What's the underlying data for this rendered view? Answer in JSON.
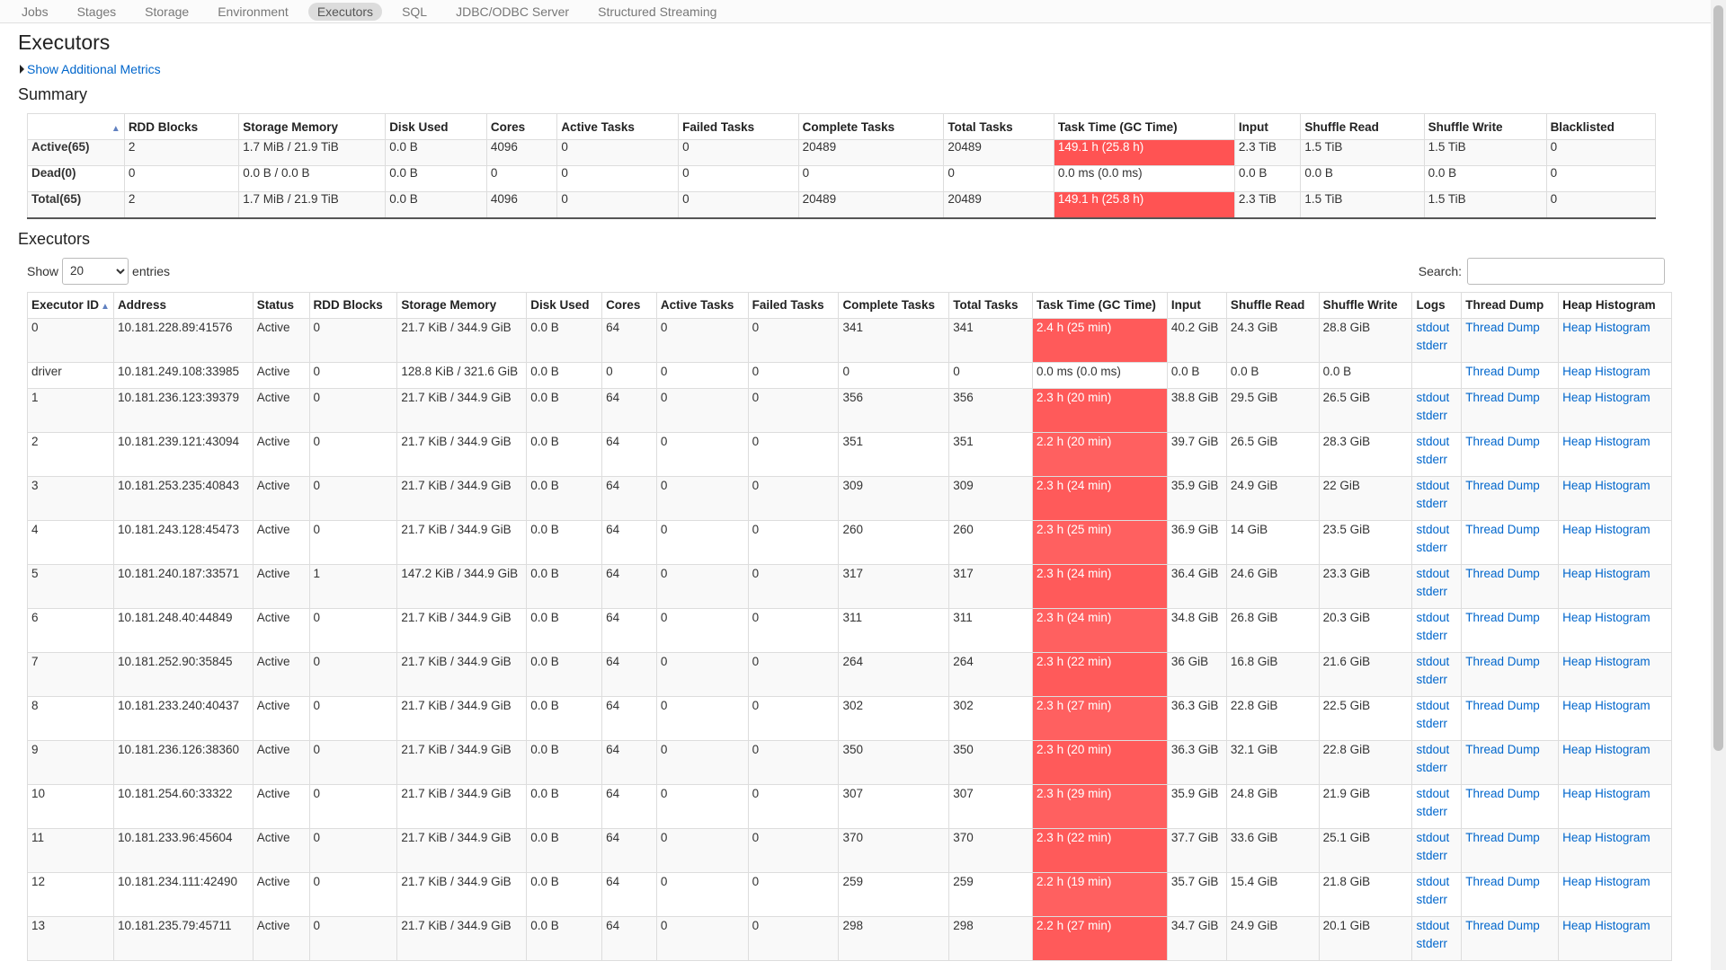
{
  "nav": [
    "Jobs",
    "Stages",
    "Storage",
    "Environment",
    "Executors",
    "SQL",
    "JDBC/ODBC Server",
    "Structured Streaming"
  ],
  "nav_active": "Executors",
  "page_title": "Executors",
  "show_more": "Show Additional Metrics",
  "summary_title": "Summary",
  "summary_headers": [
    "",
    "RDD Blocks",
    "Storage Memory",
    "Disk Used",
    "Cores",
    "Active Tasks",
    "Failed Tasks",
    "Complete Tasks",
    "Total Tasks",
    "Task Time (GC Time)",
    "Input",
    "Shuffle Read",
    "Shuffle Write",
    "Blacklisted"
  ],
  "summary_rows": [
    [
      "Active(65)",
      "2",
      "1.7 MiB / 21.9 TiB",
      "0.0 B",
      "4096",
      "0",
      "0",
      "20489",
      "20489",
      "149.1 h (25.8 h)",
      "2.3 TiB",
      "1.5 TiB",
      "1.5 TiB",
      "0"
    ],
    [
      "Dead(0)",
      "0",
      "0.0 B / 0.0 B",
      "0.0 B",
      "0",
      "0",
      "0",
      "0",
      "0",
      "0.0 ms (0.0 ms)",
      "0.0 B",
      "0.0 B",
      "0.0 B",
      "0"
    ],
    [
      "Total(65)",
      "2",
      "1.7 MiB / 21.9 TiB",
      "0.0 B",
      "4096",
      "0",
      "0",
      "20489",
      "20489",
      "149.1 h (25.8 h)",
      "2.3 TiB",
      "1.5 TiB",
      "1.5 TiB",
      "0"
    ]
  ],
  "executors_title": "Executors",
  "show_label": "Show",
  "entries_value": "20",
  "entries_label": "entries",
  "search_label": "Search:",
  "search_value": "",
  "exec_headers": [
    "Executor ID",
    "Address",
    "Status",
    "RDD Blocks",
    "Storage Memory",
    "Disk Used",
    "Cores",
    "Active Tasks",
    "Failed Tasks",
    "Complete Tasks",
    "Total Tasks",
    "Task Time (GC Time)",
    "Input",
    "Shuffle Read",
    "Shuffle Write",
    "Logs",
    "Thread Dump",
    "Heap Histogram"
  ],
  "log_links": [
    "stdout",
    "stderr"
  ],
  "thread_dump_label": "Thread Dump",
  "heap_histogram_label": "Heap Histogram",
  "executors": [
    {
      "id": "0",
      "address": "10.181.228.89:41576",
      "status": "Active",
      "rdd": "0",
      "storage": "21.7 KiB / 344.9 GiB",
      "disk": "0.0 B",
      "cores": "64",
      "active": "0",
      "failed": "0",
      "complete": "341",
      "total": "341",
      "task_time": "2.4 h (25 min)",
      "input": "40.2 GiB",
      "shuffle_read": "24.3 GiB",
      "shuffle_write": "28.8 GiB",
      "logs": true
    },
    {
      "id": "driver",
      "address": "10.181.249.108:33985",
      "status": "Active",
      "rdd": "0",
      "storage": "128.8 KiB / 321.6 GiB",
      "disk": "0.0 B",
      "cores": "0",
      "active": "0",
      "failed": "0",
      "complete": "0",
      "total": "0",
      "task_time": "0.0 ms (0.0 ms)",
      "input": "0.0 B",
      "shuffle_read": "0.0 B",
      "shuffle_write": "0.0 B",
      "logs": false
    },
    {
      "id": "1",
      "address": "10.181.236.123:39379",
      "status": "Active",
      "rdd": "0",
      "storage": "21.7 KiB / 344.9 GiB",
      "disk": "0.0 B",
      "cores": "64",
      "active": "0",
      "failed": "0",
      "complete": "356",
      "total": "356",
      "task_time": "2.3 h (20 min)",
      "input": "38.8 GiB",
      "shuffle_read": "29.5 GiB",
      "shuffle_write": "26.5 GiB",
      "logs": true
    },
    {
      "id": "2",
      "address": "10.181.239.121:43094",
      "status": "Active",
      "rdd": "0",
      "storage": "21.7 KiB / 344.9 GiB",
      "disk": "0.0 B",
      "cores": "64",
      "active": "0",
      "failed": "0",
      "complete": "351",
      "total": "351",
      "task_time": "2.2 h (20 min)",
      "input": "39.7 GiB",
      "shuffle_read": "26.5 GiB",
      "shuffle_write": "28.3 GiB",
      "logs": true
    },
    {
      "id": "3",
      "address": "10.181.253.235:40843",
      "status": "Active",
      "rdd": "0",
      "storage": "21.7 KiB / 344.9 GiB",
      "disk": "0.0 B",
      "cores": "64",
      "active": "0",
      "failed": "0",
      "complete": "309",
      "total": "309",
      "task_time": "2.3 h (24 min)",
      "input": "35.9 GiB",
      "shuffle_read": "24.9 GiB",
      "shuffle_write": "22 GiB",
      "logs": true
    },
    {
      "id": "4",
      "address": "10.181.243.128:45473",
      "status": "Active",
      "rdd": "0",
      "storage": "21.7 KiB / 344.9 GiB",
      "disk": "0.0 B",
      "cores": "64",
      "active": "0",
      "failed": "0",
      "complete": "260",
      "total": "260",
      "task_time": "2.3 h (25 min)",
      "input": "36.9 GiB",
      "shuffle_read": "14 GiB",
      "shuffle_write": "23.5 GiB",
      "logs": true
    },
    {
      "id": "5",
      "address": "10.181.240.187:33571",
      "status": "Active",
      "rdd": "1",
      "storage": "147.2 KiB / 344.9 GiB",
      "disk": "0.0 B",
      "cores": "64",
      "active": "0",
      "failed": "0",
      "complete": "317",
      "total": "317",
      "task_time": "2.3 h (24 min)",
      "input": "36.4 GiB",
      "shuffle_read": "24.6 GiB",
      "shuffle_write": "23.3 GiB",
      "logs": true
    },
    {
      "id": "6",
      "address": "10.181.248.40:44849",
      "status": "Active",
      "rdd": "0",
      "storage": "21.7 KiB / 344.9 GiB",
      "disk": "0.0 B",
      "cores": "64",
      "active": "0",
      "failed": "0",
      "complete": "311",
      "total": "311",
      "task_time": "2.3 h (24 min)",
      "input": "34.8 GiB",
      "shuffle_read": "26.8 GiB",
      "shuffle_write": "20.3 GiB",
      "logs": true
    },
    {
      "id": "7",
      "address": "10.181.252.90:35845",
      "status": "Active",
      "rdd": "0",
      "storage": "21.7 KiB / 344.9 GiB",
      "disk": "0.0 B",
      "cores": "64",
      "active": "0",
      "failed": "0",
      "complete": "264",
      "total": "264",
      "task_time": "2.3 h (22 min)",
      "input": "36 GiB",
      "shuffle_read": "16.8 GiB",
      "shuffle_write": "21.6 GiB",
      "logs": true
    },
    {
      "id": "8",
      "address": "10.181.233.240:40437",
      "status": "Active",
      "rdd": "0",
      "storage": "21.7 KiB / 344.9 GiB",
      "disk": "0.0 B",
      "cores": "64",
      "active": "0",
      "failed": "0",
      "complete": "302",
      "total": "302",
      "task_time": "2.3 h (27 min)",
      "input": "36.3 GiB",
      "shuffle_read": "22.8 GiB",
      "shuffle_write": "22.5 GiB",
      "logs": true
    },
    {
      "id": "9",
      "address": "10.181.236.126:38360",
      "status": "Active",
      "rdd": "0",
      "storage": "21.7 KiB / 344.9 GiB",
      "disk": "0.0 B",
      "cores": "64",
      "active": "0",
      "failed": "0",
      "complete": "350",
      "total": "350",
      "task_time": "2.3 h (20 min)",
      "input": "36.3 GiB",
      "shuffle_read": "32.1 GiB",
      "shuffle_write": "22.8 GiB",
      "logs": true
    },
    {
      "id": "10",
      "address": "10.181.254.60:33322",
      "status": "Active",
      "rdd": "0",
      "storage": "21.7 KiB / 344.9 GiB",
      "disk": "0.0 B",
      "cores": "64",
      "active": "0",
      "failed": "0",
      "complete": "307",
      "total": "307",
      "task_time": "2.3 h (29 min)",
      "input": "35.9 GiB",
      "shuffle_read": "24.8 GiB",
      "shuffle_write": "21.9 GiB",
      "logs": true
    },
    {
      "id": "11",
      "address": "10.181.233.96:45604",
      "status": "Active",
      "rdd": "0",
      "storage": "21.7 KiB / 344.9 GiB",
      "disk": "0.0 B",
      "cores": "64",
      "active": "0",
      "failed": "0",
      "complete": "370",
      "total": "370",
      "task_time": "2.3 h (22 min)",
      "input": "37.7 GiB",
      "shuffle_read": "33.6 GiB",
      "shuffle_write": "25.1 GiB",
      "logs": true
    },
    {
      "id": "12",
      "address": "10.181.234.111:42490",
      "status": "Active",
      "rdd": "0",
      "storage": "21.7 KiB / 344.9 GiB",
      "disk": "0.0 B",
      "cores": "64",
      "active": "0",
      "failed": "0",
      "complete": "259",
      "total": "259",
      "task_time": "2.2 h (19 min)",
      "input": "35.7 GiB",
      "shuffle_read": "15.4 GiB",
      "shuffle_write": "21.8 GiB",
      "logs": true
    },
    {
      "id": "13",
      "address": "10.181.235.79:45711",
      "status": "Active",
      "rdd": "0",
      "storage": "21.7 KiB / 344.9 GiB",
      "disk": "0.0 B",
      "cores": "64",
      "active": "0",
      "failed": "0",
      "complete": "298",
      "total": "298",
      "task_time": "2.2 h (27 min)",
      "input": "34.7 GiB",
      "shuffle_read": "24.9 GiB",
      "shuffle_write": "20.1 GiB",
      "logs": true
    }
  ],
  "colors": {
    "hot": "#ff5353",
    "link": "#0066cc"
  }
}
